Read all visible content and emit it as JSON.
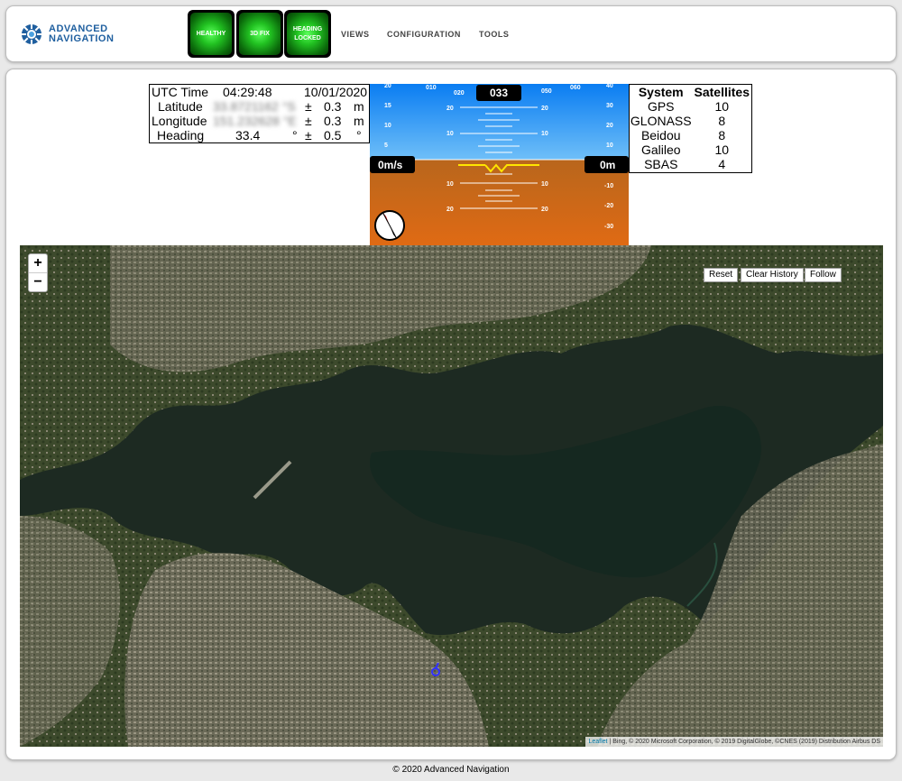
{
  "brand": {
    "line1": "ADVANCED",
    "line2": "NAVIGATION"
  },
  "status": {
    "healthy": "HEALTHY",
    "fix": "3D FIX",
    "heading_line1": "HEADING",
    "heading_line2": "LOCKED"
  },
  "nav": {
    "views": "VIEWS",
    "configuration": "CONFIGURATION",
    "tools": "TOOLS"
  },
  "position": {
    "utc_label": "UTC Time",
    "utc_time": "04:29:48",
    "utc_date": "10/01/2020",
    "lat_label": "Latitude",
    "lat_value": "33.8721162 °S",
    "lat_pm": "±",
    "lat_acc": "0.3",
    "lat_unit": "m",
    "lon_label": "Longitude",
    "lon_value": "151.232628 °E",
    "lon_pm": "±",
    "lon_acc": "0.3",
    "lon_unit": "m",
    "hdg_label": "Heading",
    "hdg_value": "33.4",
    "hdg_deg": "°",
    "hdg_pm": "±",
    "hdg_acc": "0.5",
    "hdg_unit": "°"
  },
  "adi": {
    "heading_readout": "033",
    "speed": "0m/s",
    "altitude": "0m",
    "heading_ticks": [
      "010",
      "020",
      "050",
      "060"
    ],
    "pitch_labels_up": [
      "10",
      "20"
    ],
    "pitch_labels_down": [
      "10",
      "20"
    ],
    "alt_scale": [
      "40",
      "30",
      "20",
      "10",
      "-10",
      "-20",
      "-30"
    ],
    "left_scale_top": [
      "20",
      "15",
      "10",
      "5"
    ],
    "sky_color": "#0a7df2",
    "ground_color": "#e06a14"
  },
  "satellites": {
    "headers": [
      "System",
      "Satellites"
    ],
    "rows": [
      [
        "GPS",
        "10"
      ],
      [
        "GLONASS",
        "8"
      ],
      [
        "Beidou",
        "8"
      ],
      [
        "Galileo",
        "10"
      ],
      [
        "SBAS",
        "4"
      ]
    ]
  },
  "map": {
    "zoom_in": "+",
    "zoom_out": "−",
    "reset": "Reset",
    "clear_history": "Clear History",
    "follow": "Follow",
    "attribution_link": "Leaflet",
    "attribution_text": "| Bing, © 2020 Microsoft Corporation, © 2019 DigitalGlobe, ©CNES (2019) Distribution Airbus DS"
  },
  "footer": "© 2020 Advanced Navigation"
}
